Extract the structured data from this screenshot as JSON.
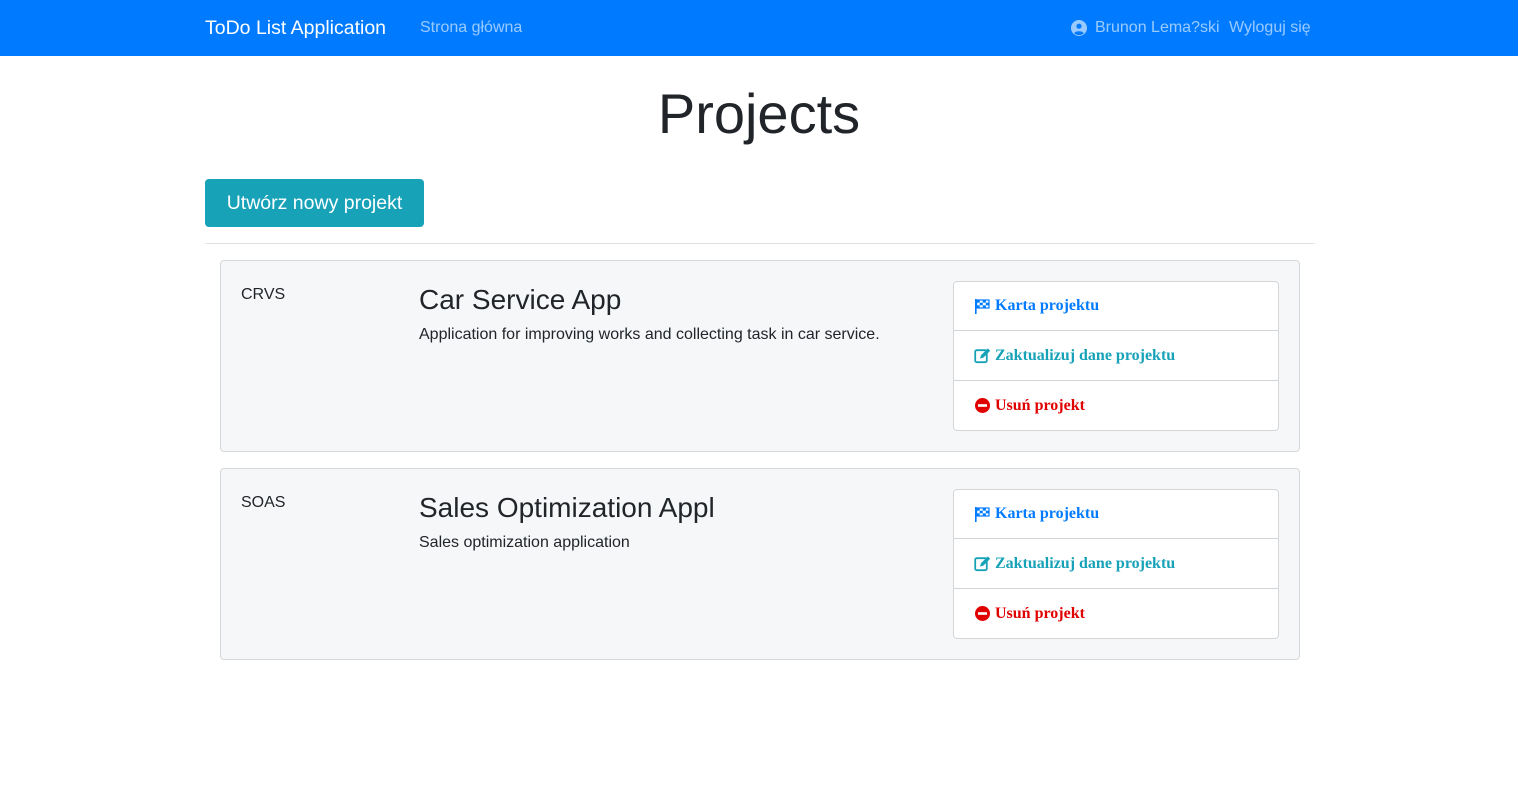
{
  "navbar": {
    "brand": "ToDo List Application",
    "home": "Strona główna",
    "user": "Brunon Lema?ski",
    "logout": "Wyloguj się",
    "user_icon": "user-circle-icon"
  },
  "page": {
    "title": "Projects",
    "create_button": "Utwórz nowy projekt"
  },
  "colors": {
    "navbar": "#007bff",
    "info": "#17a2b8",
    "primary": "#007bff",
    "danger": "#e00000"
  },
  "projects": [
    {
      "code": "CRVS",
      "name": "Car Service App",
      "description": "Application for improving works and collecting task in car service.",
      "actions": {
        "card": "Karta projektu",
        "update": "Zaktualizuj dane projektu",
        "delete": "Usuń projekt"
      }
    },
    {
      "code": "SOAS",
      "name": "Sales Optimization Appl",
      "description": "Sales optimization application",
      "actions": {
        "card": "Karta projektu",
        "update": "Zaktualizuj dane projektu",
        "delete": "Usuń projekt"
      }
    }
  ],
  "icons": {
    "card": "checkered-flag-icon",
    "update": "edit-icon",
    "delete": "minus-circle-icon"
  }
}
